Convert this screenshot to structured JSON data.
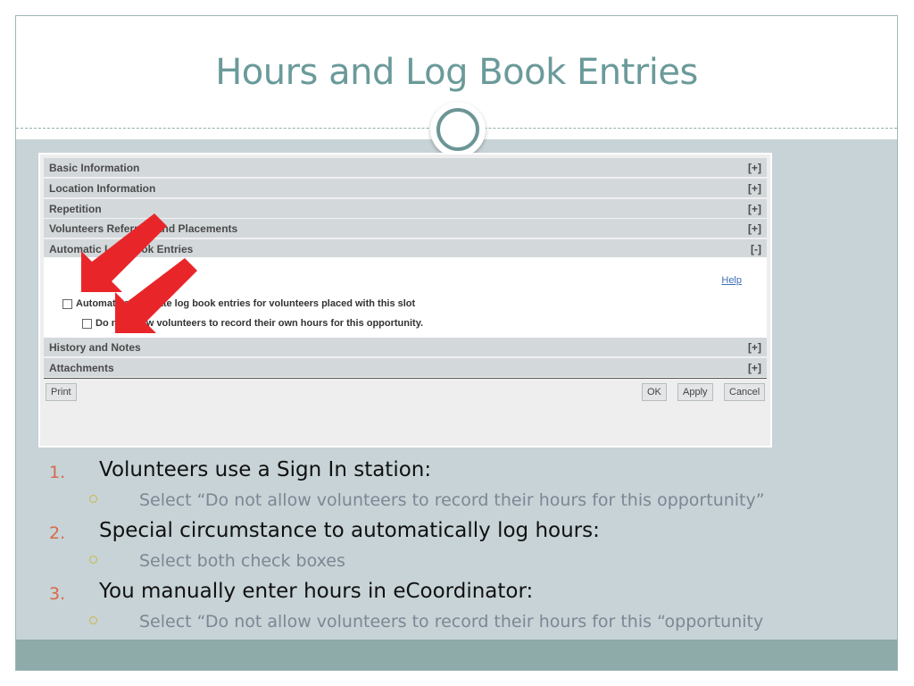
{
  "slide": {
    "title": "Hours and Log Book Entries"
  },
  "form": {
    "sections": [
      {
        "label": "Basic Information",
        "toggle": "[+]"
      },
      {
        "label": "Location Information",
        "toggle": "[+]"
      },
      {
        "label": "Repetition",
        "toggle": "[+]"
      },
      {
        "label": "Volunteers Referrals and Placements",
        "toggle": "[+]"
      },
      {
        "label": "Automatic Log Book Entries",
        "toggle": "[-]"
      },
      {
        "label": "History and Notes",
        "toggle": "[+]"
      },
      {
        "label": "Attachments",
        "toggle": "[+]"
      }
    ],
    "help_link": "Help",
    "checkbox_auto": {
      "label": "Automatically create log book entries for volunteers placed with this slot",
      "checked": false
    },
    "checkbox_no_self": {
      "label": "Do not allow volunteers to record their own hours for this opportunity.",
      "checked": false
    },
    "buttons": {
      "print": "Print",
      "ok": "OK",
      "apply": "Apply",
      "cancel": "Cancel"
    },
    "annotation_color": "#e8262a"
  },
  "list": [
    {
      "num": "1.",
      "text": "Volunteers use a Sign In station:",
      "sub": "Select “Do not allow volunteers to record their hours for this opportunity”"
    },
    {
      "num": "2.",
      "text": "Special circumstance to automatically log hours:",
      "sub": "Select both check boxes"
    },
    {
      "num": "3.",
      "text": "You manually enter hours in eCoordinator:",
      "sub": "Select “Do not allow volunteers to record their hours for this “opportunity"
    }
  ],
  "colors": {
    "accent": "#6b9a9a",
    "number": "#d9694a",
    "bullet": "#c9b74a",
    "body_bg": "#c7d3d6",
    "footer_bg": "#8eaaa9"
  }
}
